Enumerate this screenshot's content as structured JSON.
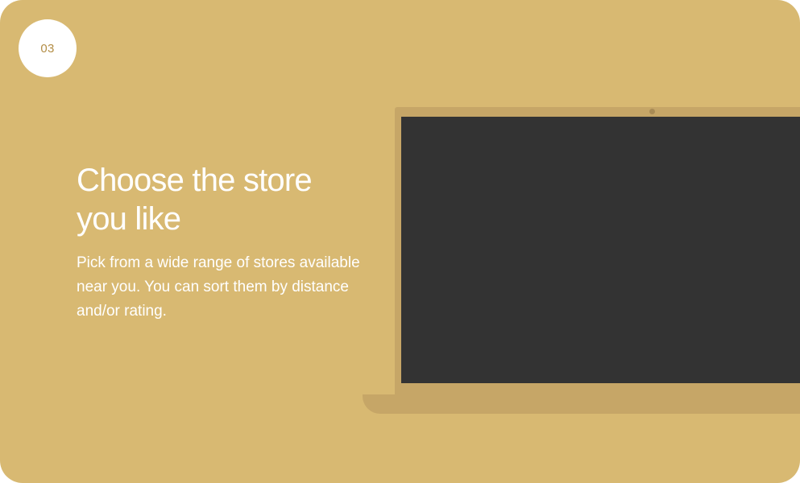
{
  "step": {
    "number": "03"
  },
  "content": {
    "title": "Choose the store you like",
    "description": "Pick from a wide range of stores available near you. You can sort them by distance and/or rating."
  },
  "colors": {
    "background": "#d8b972",
    "badge_text": "#b38d45",
    "laptop_body": "#c6a667",
    "laptop_camera": "#a88b55",
    "laptop_screen": "#333333",
    "text": "#ffffff"
  },
  "illustration": {
    "laptop_screen_content": ""
  }
}
